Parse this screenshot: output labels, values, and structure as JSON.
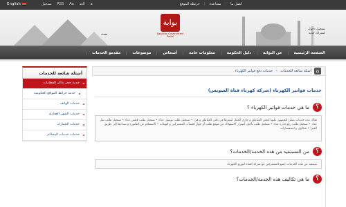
{
  "topbar": {
    "language": "English",
    "tools": [
      "تسجيل",
      "RSS",
      "Aa",
      "العد",
      "a"
    ],
    "links": [
      "اتصل بنا",
      "مساعدة",
      "خريطة الموقع"
    ]
  },
  "header": {
    "logo_text": "بوابة",
    "logo_tagline": "Egyptian Government Portal",
    "search_label": "بحث",
    "register_line1": "تسجيل دخول",
    "register_line2": "اشتراك جديد"
  },
  "nav": {
    "items": [
      "الصفحة الرئيسية",
      "عن البوابة",
      "دليل الحكومة",
      "معلومات عامة",
      "أشخاص",
      "موضوعات",
      "مقدمو الخدمات"
    ]
  },
  "breadcrumb": {
    "items": [
      "أسئلة شائعة للخدمات",
      "خدمات دفع فواتير الكهرباء"
    ]
  },
  "page": {
    "title": "خدمات فواتير الكهرباء (شركة كهرباء قناة السويس)"
  },
  "questions": [
    {
      "text": "ما هي خدمات فواتير الكهرباء ؟",
      "answer": "هناك عدة خدمات يمكن للجمهور عليها لبعض المناطق و جاري العمل لنشرها في باقي المناطق و هي: • تسجيل طلب توصيل عداد • تسجيل طلب فحص عداد • تسجيل طلب نقل عداد • تسجيل طلب رفع قدرة عداد • تسجيل طلب تأجيل أسترار الاستهلاك من موقع طلب أو جهاز لحساب المشتركين و الهيئات • الاستعلام عن الفاتورة و سدادها إلى طريق الفيزا • شكاوى و استفسارات"
    },
    {
      "text": "من المستفيد من هذه الخدمة/الخدمات؟",
      "answer": "يستفيد من هذه الخدمات جميع المشتركين مع شركة القناة لتوزيع الكهرباء"
    },
    {
      "text": "ما هي تكاليف هذه الخدمة/الخدمات؟",
      "answer": ""
    }
  ],
  "sidebar": {
    "title": "أسئلة شائعة للخدمات",
    "items": [
      {
        "label": "خدمة حجز تذاكر القطارات",
        "active": true,
        "sub": false
      },
      {
        "label": "خدمة خرائط المواقع الحكومية",
        "active": false,
        "sub": true
      },
      {
        "label": "خدمات الهاتف",
        "active": false,
        "sub": false
      },
      {
        "label": "خدمات الشهر العقاري",
        "active": false,
        "sub": false
      },
      {
        "label": "خدمات الجمارك",
        "active": false,
        "sub": false
      },
      {
        "label": "خدمات خدمات المحاكم",
        "active": false,
        "sub": false
      }
    ]
  }
}
